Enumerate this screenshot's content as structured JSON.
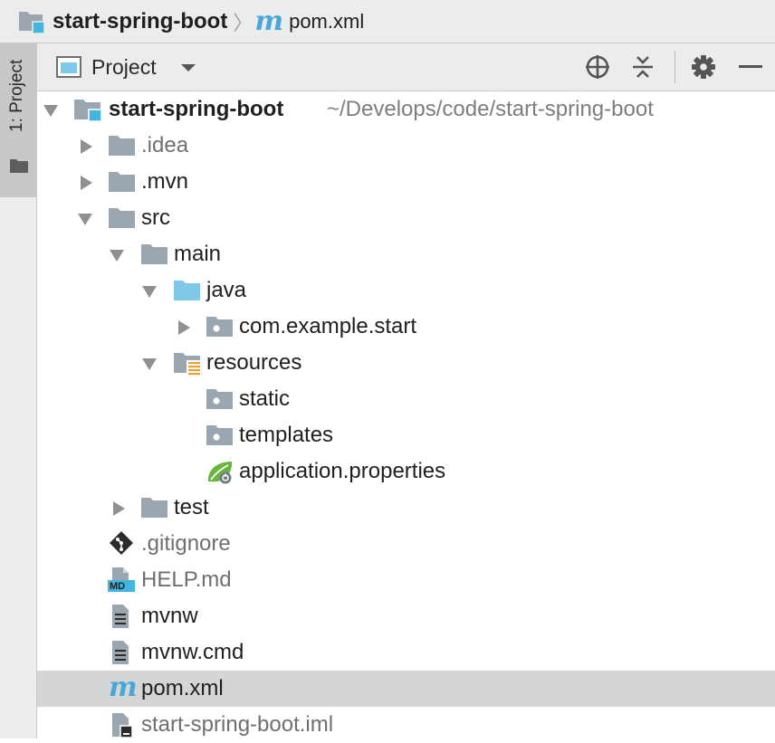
{
  "breadcrumb": {
    "project": "start-spring-boot",
    "separator": "〉",
    "file": "pom.xml",
    "maven_glyph": "m"
  },
  "tool_strip": {
    "project_tab": "1: Project"
  },
  "header": {
    "title": "Project"
  },
  "tree": {
    "root": {
      "name": "start-spring-boot",
      "path": "~/Develops/code/start-spring-boot"
    },
    "items": [
      {
        "label": ".idea"
      },
      {
        "label": ".mvn"
      },
      {
        "label": "src"
      },
      {
        "label": "main"
      },
      {
        "label": "java"
      },
      {
        "label": "com.example.start"
      },
      {
        "label": "resources"
      },
      {
        "label": "static"
      },
      {
        "label": "templates"
      },
      {
        "label": "application.properties"
      },
      {
        "label": "test"
      },
      {
        "label": ".gitignore"
      },
      {
        "label": "HELP.md",
        "badge": "MD"
      },
      {
        "label": "mvnw"
      },
      {
        "label": "mvnw.cmd"
      },
      {
        "label": "pom.xml"
      },
      {
        "label": "start-spring-boot.iml"
      }
    ]
  },
  "colors": {
    "folder": "#9aa7b0",
    "source_folder": "#7fc8e8",
    "module_badge": "#40b6e0",
    "resource_bars": "#e2a23a",
    "spring_green": "#6db33f",
    "maven_blue": "#4aa8d8",
    "selection": "#d5d5d5"
  },
  "icons": [
    "module-folder-icon",
    "folder-icon",
    "source-folder-icon",
    "package-icon",
    "resources-folder-icon",
    "spring-leaf-icon",
    "git-icon",
    "markdown-file-icon",
    "text-file-icon",
    "maven-icon",
    "iml-file-icon",
    "locate-icon",
    "collapse-icon",
    "gear-icon",
    "minimize-icon"
  ]
}
